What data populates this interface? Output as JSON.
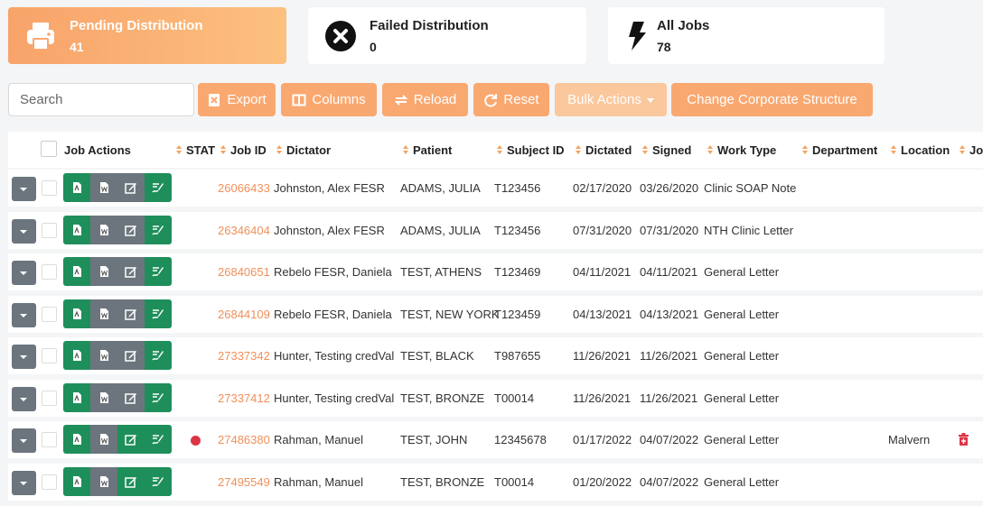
{
  "cards": [
    {
      "title": "Pending Distribution",
      "count": "41",
      "icon": "printer-icon"
    },
    {
      "title": "Failed Distribution",
      "count": "0",
      "icon": "x-circle-icon"
    },
    {
      "title": "All Jobs",
      "count": "78",
      "icon": "lightning-icon"
    }
  ],
  "toolbar": {
    "search_placeholder": "Search",
    "export": "Export",
    "columns": "Columns",
    "reload": "Reload",
    "reset": "Reset",
    "bulk": "Bulk Actions",
    "change": "Change Corporate Structure"
  },
  "columns": [
    "Job Actions",
    "STAT",
    "Job ID",
    "Dictator",
    "Patient",
    "Subject ID",
    "Dictated",
    "Signed",
    "Work Type",
    "Department",
    "Location",
    "Jo"
  ],
  "rows": [
    {
      "job_id": "26066433",
      "dictator": "Johnston, Alex FESR",
      "patient": "ADAMS, JULIA",
      "subject": "T123456",
      "dictated": "02/17/2020",
      "signed": "03/26/2020",
      "work": "Clinic SOAP Note",
      "location": "",
      "stat": false,
      "edit_green": false
    },
    {
      "job_id": "26346404",
      "dictator": "Johnston, Alex FESR",
      "patient": "ADAMS, JULIA",
      "subject": "T123456",
      "dictated": "07/31/2020",
      "signed": "07/31/2020",
      "work": "NTH Clinic Letter",
      "location": "",
      "stat": false,
      "edit_green": false
    },
    {
      "job_id": "26840651",
      "dictator": "Rebelo FESR, Daniela",
      "patient": "TEST, ATHENS",
      "subject": "T123469",
      "dictated": "04/11/2021",
      "signed": "04/11/2021",
      "work": "General Letter",
      "location": "",
      "stat": false,
      "edit_green": false
    },
    {
      "job_id": "26844109",
      "dictator": "Rebelo FESR, Daniela",
      "patient": "TEST, NEW YORK",
      "subject": "T123459",
      "dictated": "04/13/2021",
      "signed": "04/13/2021",
      "work": "General Letter",
      "location": "",
      "stat": false,
      "edit_green": false
    },
    {
      "job_id": "27337342",
      "dictator": "Hunter, Testing credVal",
      "patient": "TEST, BLACK",
      "subject": "T987655",
      "dictated": "11/26/2021",
      "signed": "11/26/2021",
      "work": "General Letter",
      "location": "",
      "stat": false,
      "edit_green": false
    },
    {
      "job_id": "27337412",
      "dictator": "Hunter, Testing credVal",
      "patient": "TEST, BRONZE",
      "subject": "T00014",
      "dictated": "11/26/2021",
      "signed": "11/26/2021",
      "work": "General Letter",
      "location": "",
      "stat": false,
      "edit_green": false
    },
    {
      "job_id": "27486380",
      "dictator": "Rahman, Manuel",
      "patient": "TEST, JOHN",
      "subject": "12345678",
      "dictated": "01/17/2022",
      "signed": "04/07/2022",
      "work": "General Letter",
      "location": "Malvern",
      "stat": true,
      "edit_green": true
    },
    {
      "job_id": "27495549",
      "dictator": "Rahman, Manuel",
      "patient": "TEST, BRONZE",
      "subject": "T00014",
      "dictated": "01/20/2022",
      "signed": "04/07/2022",
      "work": "General Letter",
      "location": "",
      "stat": false,
      "edit_green": true
    }
  ],
  "colors": {
    "accent": "#f9a870",
    "green": "#1e8f5a",
    "grey": "#6c757d",
    "stat_red": "#dc3545",
    "link": "#f0905a"
  }
}
